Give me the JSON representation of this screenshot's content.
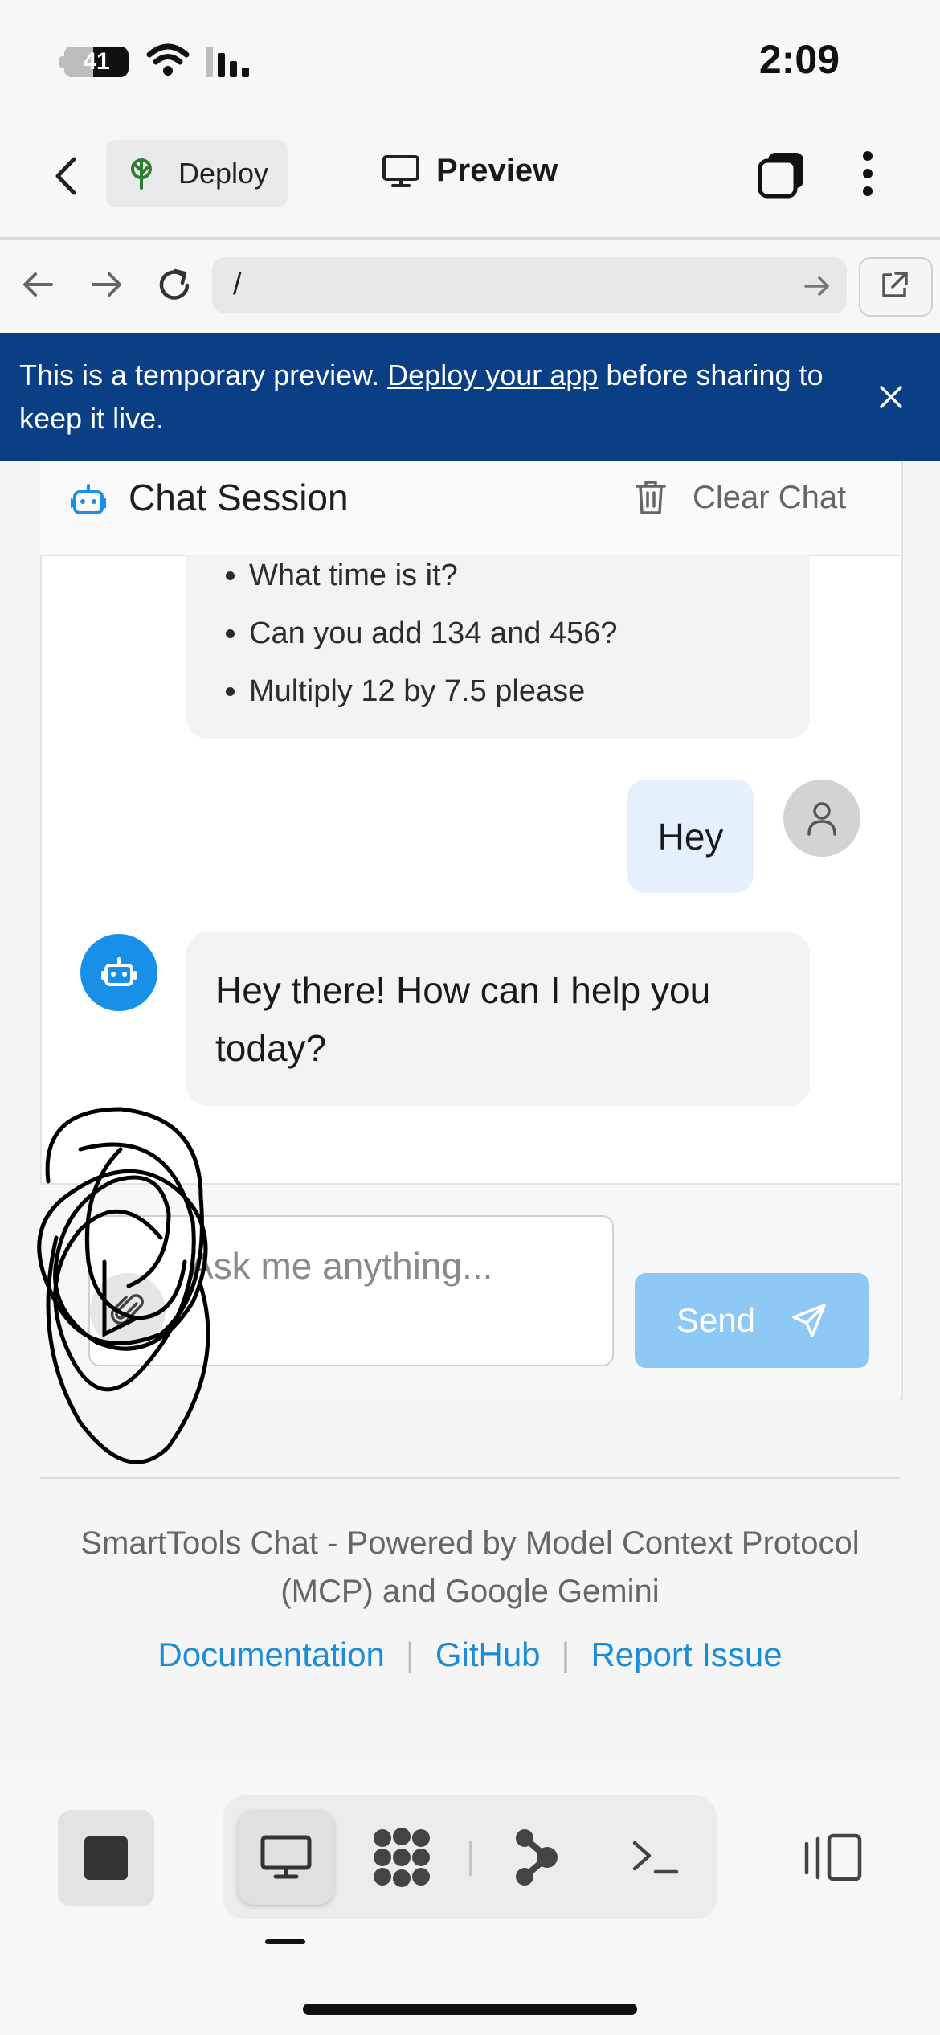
{
  "status_bar": {
    "time": "2:09",
    "battery": "41"
  },
  "top_nav": {
    "deploy_label": "Deploy",
    "preview_label": "Preview"
  },
  "url_bar": {
    "path": "/"
  },
  "banner": {
    "text_before": "This is a temporary preview. ",
    "link_text": "Deploy your app",
    "text_after": " before sharing to keep it live."
  },
  "chat": {
    "title": "Chat Session",
    "clear_label": "Clear Chat",
    "suggestions": [
      "What time is it?",
      "Can you add 134 and 456?",
      "Multiply 12 by 7.5 please"
    ],
    "user_message": "Hey",
    "bot_message": "Hey there! How can I help you today?",
    "input_placeholder": "Ask me anything...",
    "send_label": "Send"
  },
  "footer": {
    "text": "SmartTools Chat - Powered by Model Context Protocol (MCP) and Google Gemini",
    "links": [
      "Documentation",
      "GitHub",
      "Report Issue"
    ],
    "separator": "|"
  },
  "colors": {
    "banner_bg": "#0a3f85",
    "accent": "#1890e8",
    "send_bg": "#8ec9f5",
    "link": "#1a8cd8"
  }
}
